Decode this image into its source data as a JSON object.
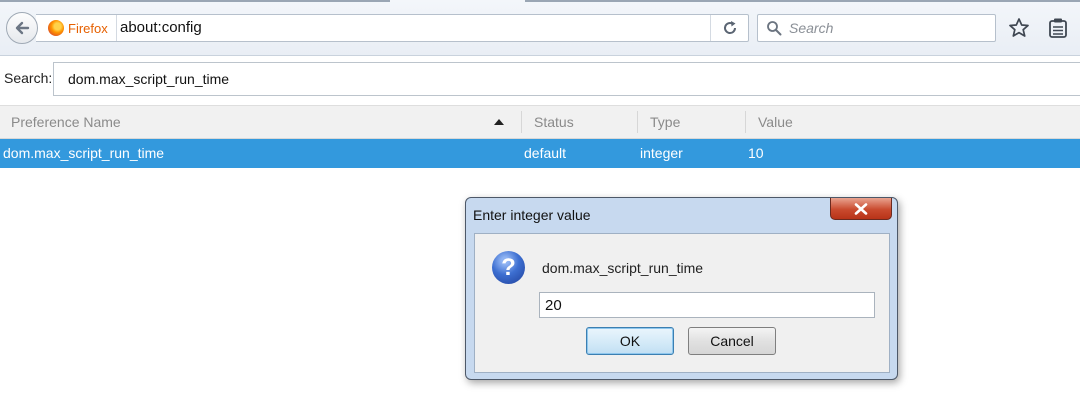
{
  "browser": {
    "identity_label": "Firefox",
    "url": "about:config",
    "search_placeholder": "Search"
  },
  "config": {
    "search_label": "Search:",
    "search_value": "dom.max_script_run_time",
    "columns": [
      "Preference Name",
      "Status",
      "Type",
      "Value"
    ],
    "rows": [
      {
        "name": "dom.max_script_run_time",
        "status": "default",
        "type": "integer",
        "value": "10"
      }
    ]
  },
  "dialog": {
    "title": "Enter integer value",
    "message": "dom.max_script_run_time",
    "input_value": "20",
    "ok_label": "OK",
    "cancel_label": "Cancel"
  },
  "colors": {
    "selected_row": "#3399dd",
    "dialog_frame": "#c7d9ef",
    "close_button": "#c94a2e",
    "firefox_label": "#e66000"
  },
  "icons": [
    "back-arrow-icon",
    "firefox-logo-icon",
    "reload-icon",
    "search-icon",
    "star-icon",
    "reading-list-icon",
    "sort-ascending-icon",
    "close-icon",
    "question-icon"
  ]
}
